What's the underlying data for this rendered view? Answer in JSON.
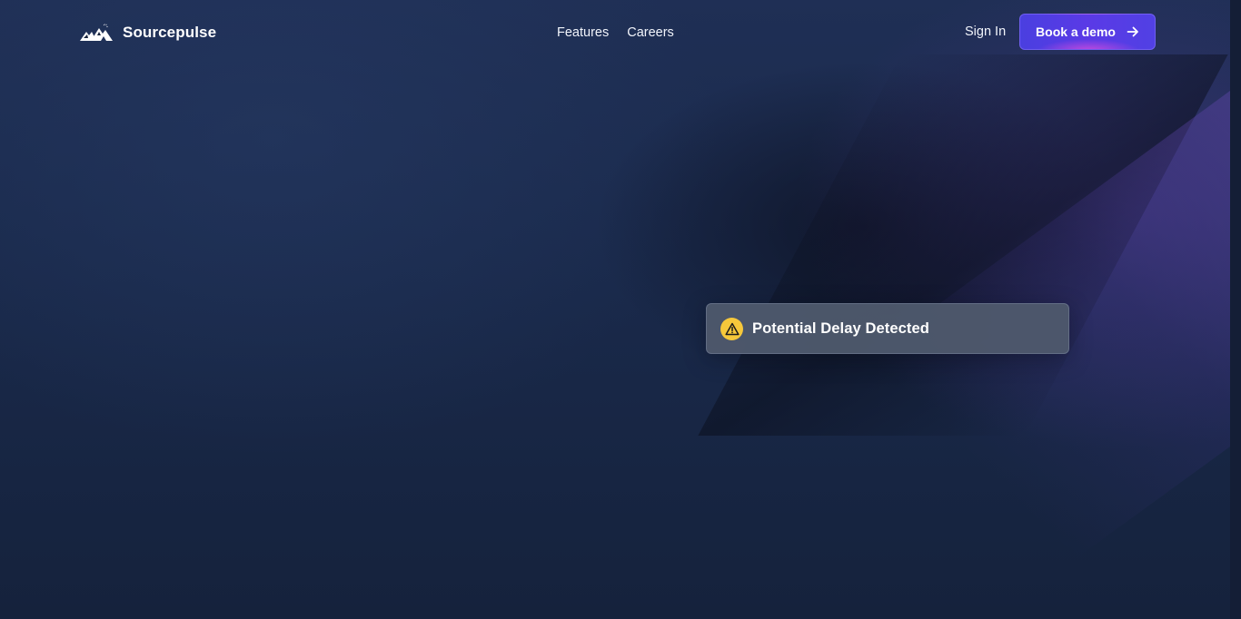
{
  "header": {
    "brand": {
      "name": "Sourcepulse",
      "logo_icon": "mountain-logo-icon"
    },
    "nav": [
      {
        "label": "Features"
      },
      {
        "label": "Careers"
      }
    ],
    "sign_in_label": "Sign In",
    "cta": {
      "label": "Book a demo",
      "icon": "arrow-right-icon"
    }
  },
  "alert": {
    "icon": "warning-icon",
    "text": "Potential Delay Detected"
  },
  "colors": {
    "cta_background": "#4a3fe0",
    "cta_glow": "#e650dc",
    "warning": "#f6c83b",
    "alert_background": "#4e586c",
    "page_background": "#1a2a4c"
  }
}
